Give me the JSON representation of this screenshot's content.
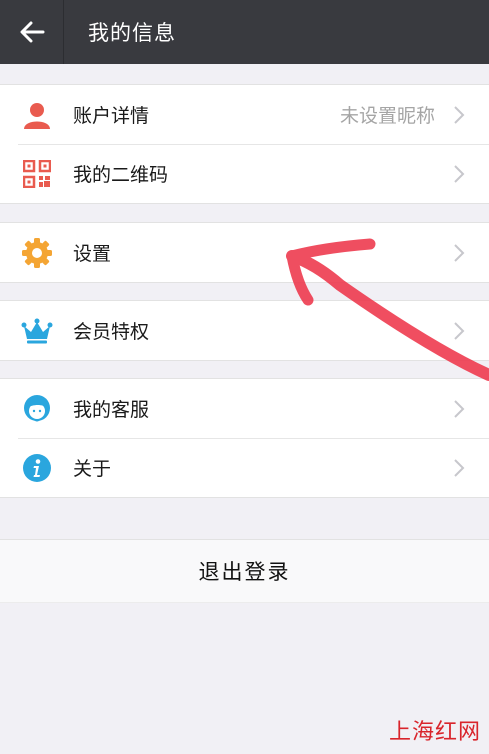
{
  "header": {
    "title": "我的信息",
    "back_icon": "arrow-left-icon"
  },
  "menu_groups": [
    {
      "items": [
        {
          "label": "账户详情",
          "value": "未设置昵称",
          "icon": "user-icon",
          "icon_color": "#e95b4f"
        },
        {
          "label": "我的二维码",
          "value": "",
          "icon": "qrcode-icon",
          "icon_color": "#e95b4f"
        }
      ]
    },
    {
      "items": [
        {
          "label": "设置",
          "value": "",
          "icon": "gear-icon",
          "icon_color": "#f4a534"
        }
      ]
    },
    {
      "items": [
        {
          "label": "会员特权",
          "value": "",
          "icon": "crown-icon",
          "icon_color": "#2aa6de"
        }
      ]
    },
    {
      "items": [
        {
          "label": "我的客服",
          "value": "",
          "icon": "customer-service-icon",
          "icon_color": "#2aa6de"
        },
        {
          "label": "关于",
          "value": "",
          "icon": "info-icon",
          "icon_color": "#2aa6de"
        }
      ]
    }
  ],
  "logout": {
    "label": "退出登录"
  },
  "watermark": "上海红网",
  "colors": {
    "titlebar": "#393a3f",
    "background": "#f1f0f5",
    "annotation_arrow": "#ee3b4f"
  }
}
